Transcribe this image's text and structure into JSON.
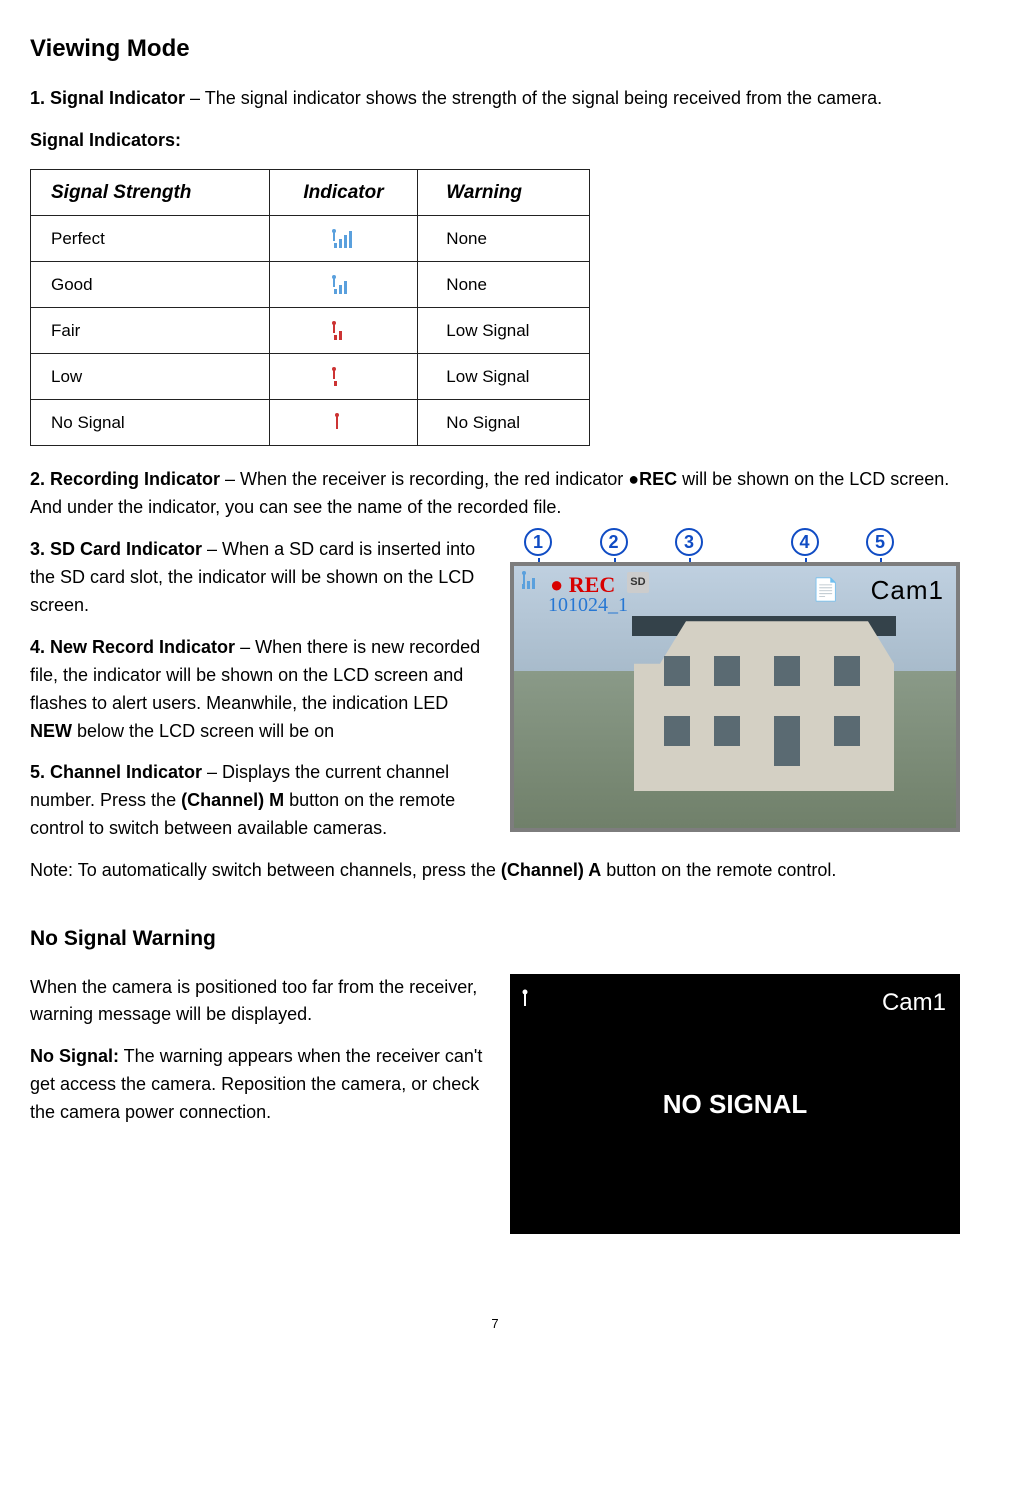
{
  "title": "Viewing Mode",
  "section1_p1a": "1. Signal Indicator",
  "section1_p1b": " – The signal indicator shows the strength of the signal being received from the camera.",
  "signal_indicators_label": "Signal Indicators:",
  "table": {
    "headers": [
      "Signal Strength",
      "Indicator",
      "Warning"
    ],
    "rows": [
      {
        "strength": "Perfect",
        "warning": "None",
        "bars": 4,
        "red": false,
        "antenna": true
      },
      {
        "strength": "Good",
        "warning": "None",
        "bars": 3,
        "red": false,
        "antenna": true
      },
      {
        "strength": "Fair",
        "warning": "Low Signal",
        "bars": 2,
        "red": true,
        "antenna": true
      },
      {
        "strength": "Low",
        "warning": "Low Signal",
        "bars": 1,
        "red": true,
        "antenna": true
      },
      {
        "strength": "No Signal",
        "warning": "No Signal",
        "bars": 0,
        "red": true,
        "antenna": true
      }
    ]
  },
  "recording": {
    "label": "2. Recording Indicator",
    "text_a": " – When the receiver is recording, the red indicator  ",
    "rec_symbol": "●REC",
    "text_b": " will be shown on the LCD screen. And under the indicator, you can see the name of the recorded file."
  },
  "sd": {
    "label": "3. SD Card Indicator",
    "text": " – When a SD card is inserted into the SD card slot, the indicator will be shown on the LCD screen."
  },
  "newrec": {
    "label": "4. New Record Indicator",
    "text_a": " – When there is new recorded file, the indicator will be shown on the LCD screen and flashes to alert users. Meanwhile, the indication LED ",
    "new_word": "NEW",
    "text_b": " below the LCD screen will be on"
  },
  "channel": {
    "label": "5. Channel Indicator",
    "text_a": " – Displays the current channel number. Press the ",
    "btn1": "(Channel) M",
    "text_b": " button on the remote control to switch between available cameras."
  },
  "note": {
    "text_a": "Note: To automatically switch between channels, press the ",
    "btn": "(Channel) A",
    "text_b": " button on the remote control."
  },
  "camera_overlay": {
    "rec": "● REC",
    "file": "101024_1",
    "sd": "SD",
    "cam": "Cam1",
    "callouts": [
      "1",
      "2",
      "3",
      "4",
      "5"
    ]
  },
  "nosignal": {
    "title": "No Signal Warning",
    "p1": "When the camera is positioned too far from the receiver, warning message will be displayed.",
    "label": "No Signal:",
    "p2": " The warning appears when the receiver can't get access the camera. Reposition the camera, or check the camera power connection.",
    "overlay_cam": "Cam1",
    "overlay_msg": "NO SIGNAL"
  },
  "page_number": "7"
}
